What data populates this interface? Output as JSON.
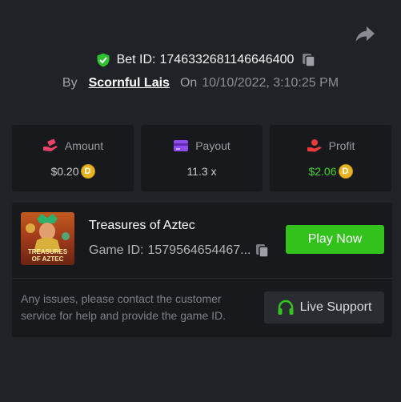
{
  "bet": {
    "id_label": "Bet ID:",
    "id_value": "1746332681146646400",
    "by_label": "By",
    "username": "Scornful Lais",
    "on_label": "On",
    "datetime": "10/10/2022, 3:10:25 PM"
  },
  "stats": [
    {
      "label": "Amount",
      "value": "$0.20",
      "coin": "D",
      "icon": "money-hand-icon",
      "icon_color": "#e8416a"
    },
    {
      "label": "Payout",
      "value": "11.3 x",
      "coin": "",
      "icon": "credit-card-icon",
      "icon_color": "#8e4cf0"
    },
    {
      "label": "Profit",
      "value": "$2.06",
      "coin": "D",
      "icon": "profit-hand-icon",
      "icon_color": "#e83a3a"
    }
  ],
  "game": {
    "title": "Treasures of Aztec",
    "id_label": "Game ID:",
    "id_value": "1579564654467...",
    "thumb_text_1": "TREASURES",
    "thumb_text_2": "OF AZTEC",
    "play_label": "Play Now"
  },
  "support": {
    "notice": "Any issues, please contact the customer service for help and provide the game ID.",
    "button_label": "Live Support"
  },
  "colors": {
    "background": "#212227",
    "card": "#18191d",
    "accent_green": "#33c11c",
    "profit_green": "#3fd52d",
    "coin_gold": "#e8b422"
  }
}
